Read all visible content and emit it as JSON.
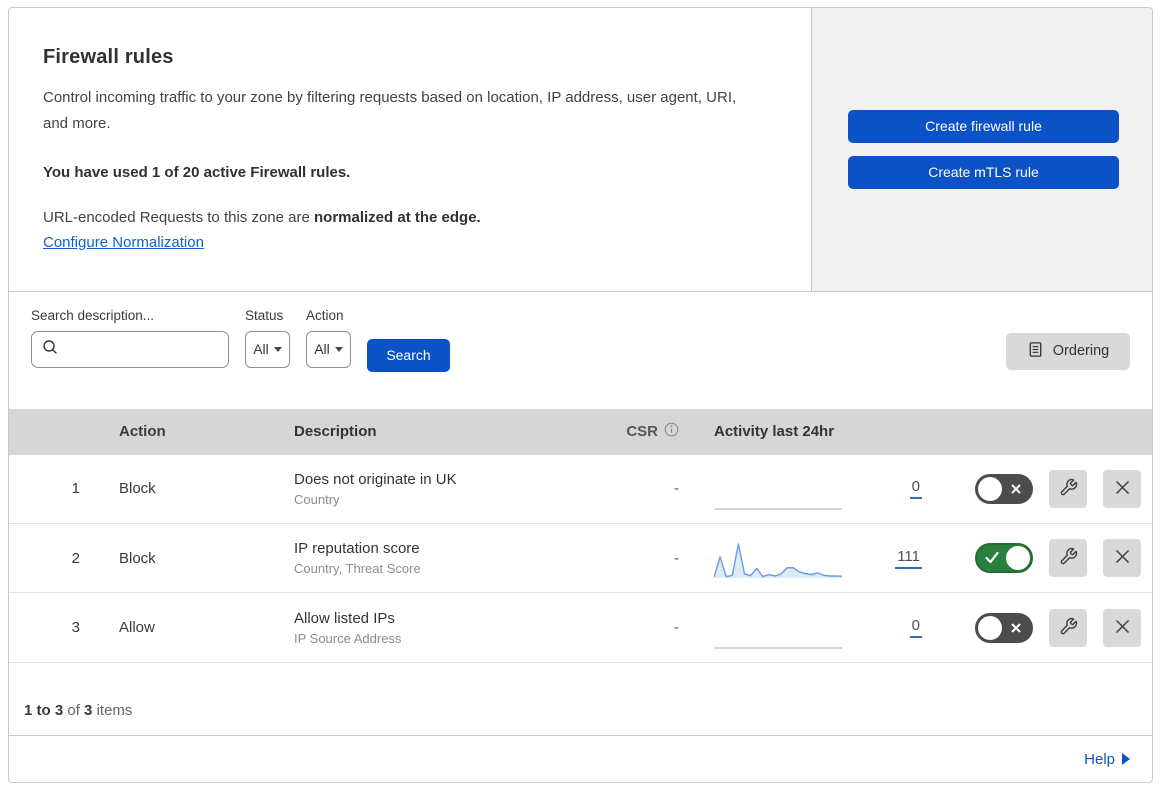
{
  "colors": {
    "accent_blue": "#0b52c6",
    "link_blue": "#1160cd",
    "toggle_on_green": "#2b7f3e",
    "toggle_off_gray": "#4c4c4c",
    "table_header_gray": "#d6d6d6",
    "side_panel_gray": "#f1f1f1",
    "sparkline_blue": "#6e9fe3",
    "count_underline_blue": "#2f6fb8"
  },
  "header": {
    "title": "Firewall rules",
    "description": "Control incoming traffic to your zone by filtering requests based on location, IP address, user agent, URI, and more.",
    "usage_text": "You have used 1 of 20 active Firewall rules.",
    "normalization_prefix": "URL-encoded Requests to this zone are ",
    "normalization_bold": "normalized at the edge.",
    "normalization_link": "Configure Normalization",
    "create_firewall_button": "Create firewall rule",
    "create_mtls_button": "Create mTLS rule"
  },
  "filters": {
    "search_label": "Search description...",
    "status_label": "Status",
    "status_value": "All",
    "action_label": "Action",
    "action_value": "All",
    "search_button": "Search",
    "ordering_button": "Ordering"
  },
  "table": {
    "columns": {
      "action": "Action",
      "description": "Description",
      "csr": "CSR",
      "activity": "Activity last 24hr"
    },
    "rows": [
      {
        "priority": "1",
        "action": "Block",
        "description": "Does not originate in UK",
        "fields": "Country",
        "csr": "-",
        "activity_count": "0",
        "activity_values": [],
        "enabled": false
      },
      {
        "priority": "2",
        "action": "Block",
        "description": "IP reputation score",
        "fields": "Country, Threat Score",
        "csr": "-",
        "activity_count": "111",
        "activity_values": [
          2,
          62,
          4,
          8,
          100,
          12,
          7,
          28,
          4,
          10,
          6,
          12,
          30,
          30,
          18,
          13,
          10,
          15,
          8,
          6,
          6,
          5
        ],
        "enabled": true
      },
      {
        "priority": "3",
        "action": "Allow",
        "description": "Allow listed IPs",
        "fields": "IP Source Address",
        "csr": "-",
        "activity_count": "0",
        "activity_values": [],
        "enabled": false
      }
    ]
  },
  "footer": {
    "range": "1 to 3",
    "of_word": "of",
    "total": "3",
    "items_word": "items"
  },
  "help": {
    "label": "Help"
  }
}
